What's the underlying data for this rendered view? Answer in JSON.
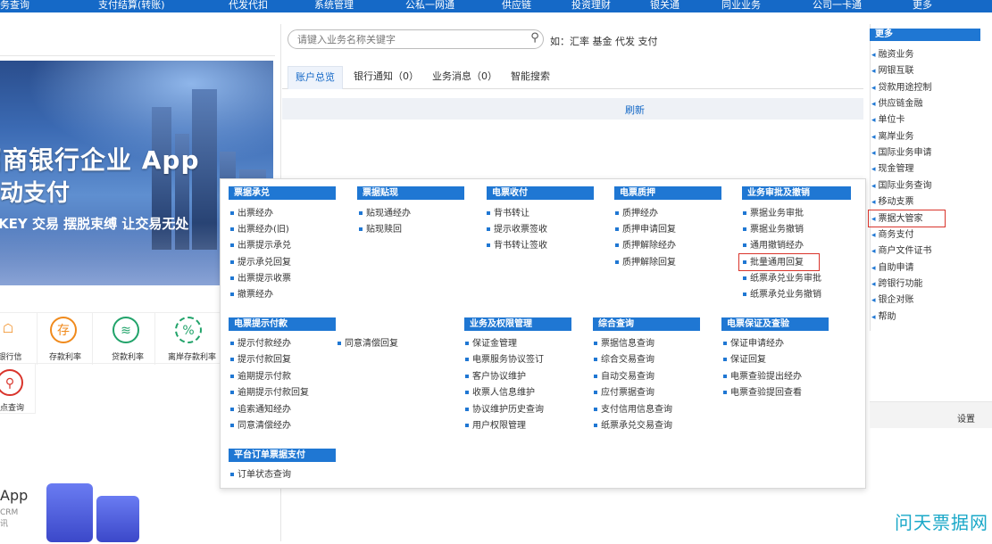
{
  "top_nav": [
    "务查询",
    "支付结算(转账)",
    "代发代扣",
    "系统管理",
    "公私一网通",
    "供应链",
    "投资理财",
    "银关通",
    "同业业务",
    "公司一卡通",
    "更多"
  ],
  "banner": {
    "title": "招商银行企业 App",
    "subtitle": "移动支付",
    "desc": "KEY 交易 摆脱束缚 让交易无处"
  },
  "quick_icons": [
    {
      "label": "银行信",
      "icon": "gift-icon",
      "glyph": " "
    },
    {
      "label": "存款利率",
      "icon": "deposit-icon",
      "glyph": "存"
    },
    {
      "label": "贷款利率",
      "icon": "coins-icon",
      "glyph": "≋"
    },
    {
      "label": "离岸存款利率",
      "icon": "percent-icon",
      "glyph": "%"
    }
  ],
  "quick_icons_2": [
    {
      "label": "网点查询",
      "icon": "location-icon"
    }
  ],
  "app_promo": {
    "title": "App",
    "sub1": "CRM",
    "sub2": "讯"
  },
  "search": {
    "placeholder": "请键入业务名称关键字",
    "hint": "如：汇率 基金 代发 支付"
  },
  "tabs": [
    "账户总览",
    "银行通知（0）",
    "业务消息（0）",
    "智能搜索"
  ],
  "refresh_label": "刷新",
  "menu": {
    "sections": [
      {
        "title": "票据承兑",
        "items": [
          "出票经办",
          "出票经办(旧)",
          "出票提示承兑",
          "提示承兑回复",
          "出票提示收票",
          "撤票经办"
        ]
      },
      {
        "title": "票据贴现",
        "items": [
          "贴现通经办",
          "贴现赎回"
        ]
      },
      {
        "title": "电票收付",
        "items": [
          "背书转让",
          "提示收票签收",
          "背书转让签收"
        ]
      },
      {
        "title": "电票质押",
        "items": [
          "质押经办",
          "质押申请回复",
          "质押解除经办",
          "质押解除回复"
        ]
      },
      {
        "title": "业务审批及撤销",
        "items": [
          "票据业务审批",
          "票据业务撤销",
          "通用撤销经办",
          "批量通用回复",
          "纸票承兑业务审批",
          "纸票承兑业务撤销"
        ]
      },
      {
        "title": "电票提示付款",
        "items": [
          "提示付款经办",
          "提示付款回复",
          "逾期提示付款",
          "逾期提示付款回复",
          "追索通知经办",
          "同意清偿经办"
        ]
      },
      {
        "title": "",
        "items": [
          "同意清偿回复"
        ]
      },
      {
        "title": "业务及权限管理",
        "items": [
          "保证金管理",
          "电票服务协议签订",
          "客户协议维护",
          "收票人信息维护",
          "协议维护历史查询",
          "用户权限管理"
        ]
      },
      {
        "title": "综合查询",
        "items": [
          "票据信息查询",
          "综合交易查询",
          "自动交易查询",
          "应付票据查询",
          "支付信用信息查询",
          "纸票承兑交易查询"
        ]
      },
      {
        "title": "电票保证及查验",
        "items": [
          "保证申请经办",
          "保证回复",
          "电票查验提出经办",
          "电票查验提回查看"
        ]
      },
      {
        "title": "平台订单票据支付",
        "items": [
          "订单状态查询"
        ]
      }
    ]
  },
  "more_menu": {
    "title": "更多",
    "items": [
      "融资业务",
      "网银互联",
      "贷款用途控制",
      "供应链金融",
      "单位卡",
      "离岸业务",
      "国际业务申请",
      "现金管理",
      "国际业务查询",
      "移动支票",
      "票据大管家",
      "商务支付",
      "商户文件证书",
      "自助申请",
      "跨银行功能",
      "银企对账",
      "帮助"
    ]
  },
  "settings_label": "设置",
  "watermark": "问天票据网",
  "colors": {
    "nav": "#1569c7",
    "menu_header": "#1f77d3",
    "highlight": "#d9342b"
  }
}
